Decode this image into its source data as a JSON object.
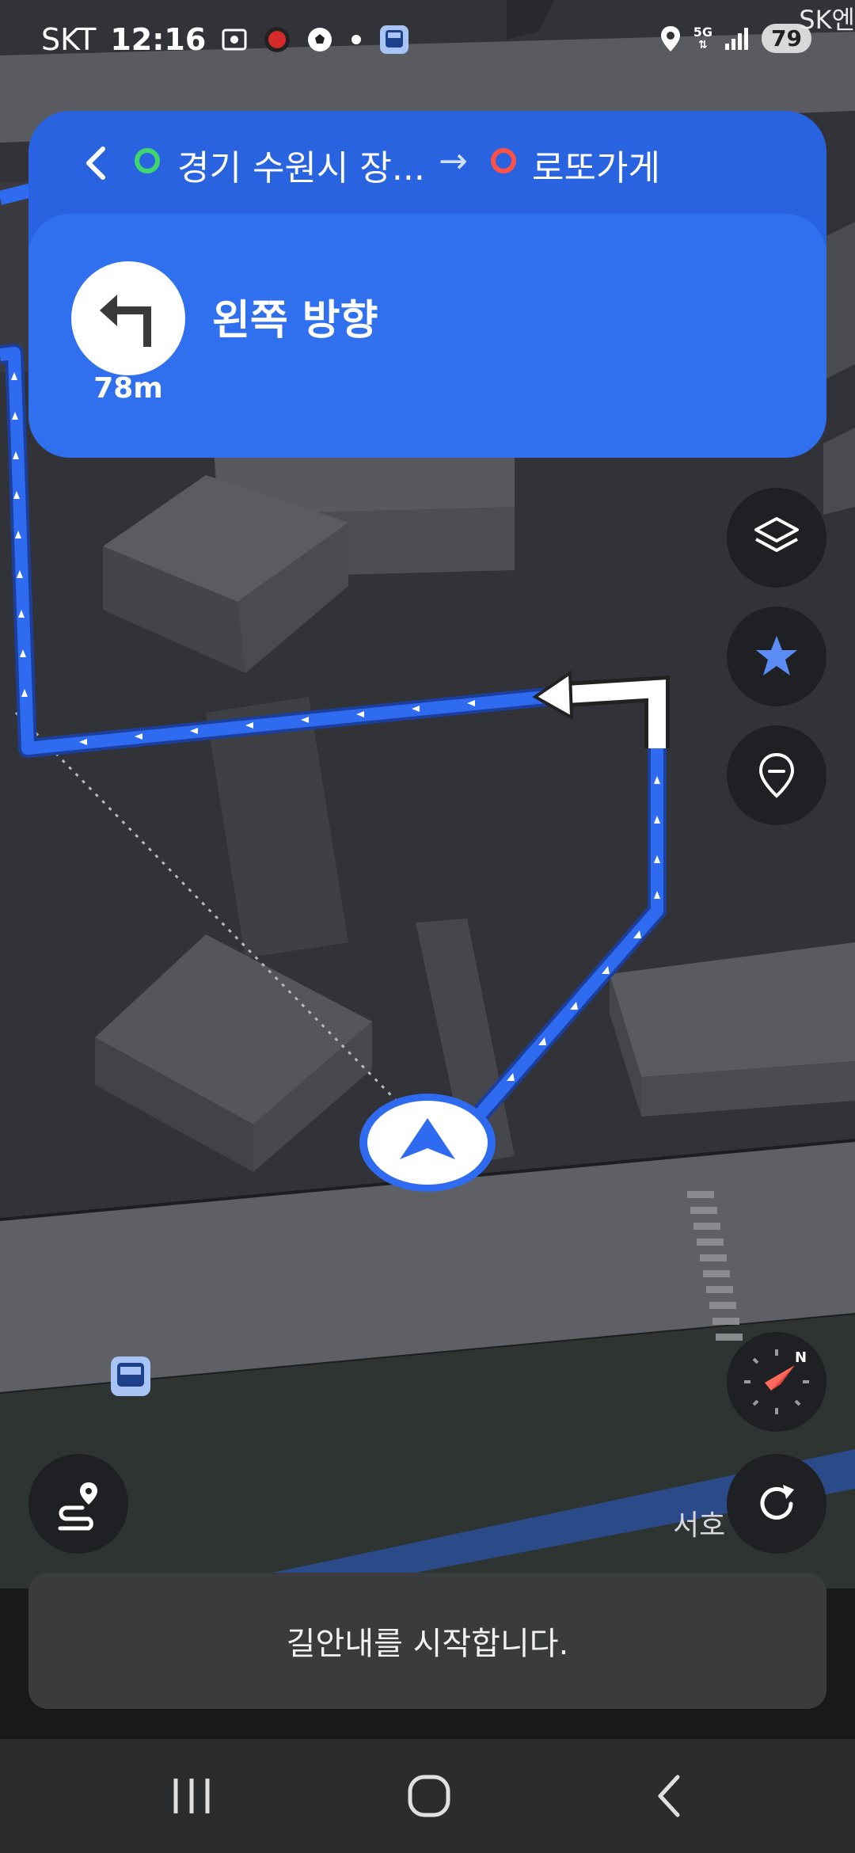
{
  "status_bar": {
    "carrier": "SKT",
    "time": "12:16",
    "network": "5G",
    "battery": "79"
  },
  "map": {
    "place_label_top": "SK엔",
    "place_label_bottom": "서호",
    "route_color": "#2f6bf0",
    "building_color": "#4a4b4f"
  },
  "route": {
    "origin": "경기 수원시 장...",
    "arrow": "→",
    "destination": "로또가게",
    "origin_color": "#3fd66b",
    "destination_color": "#ff5146"
  },
  "guidance": {
    "instruction": "왼쪽 방향",
    "distance": "78m",
    "turn_icon": "turn-left-icon"
  },
  "side_buttons": [
    "layers-icon",
    "favorite-star-icon",
    "place-pin-icon"
  ],
  "compass_icon": "compass-icon",
  "route_overview_icon": "route-overview-icon",
  "recenter_icon": "refresh-icon",
  "toast": {
    "message": "길안내를 시작합니다."
  },
  "nav_bar": {
    "buttons": [
      "recent-apps-icon",
      "home-icon",
      "back-icon"
    ]
  }
}
